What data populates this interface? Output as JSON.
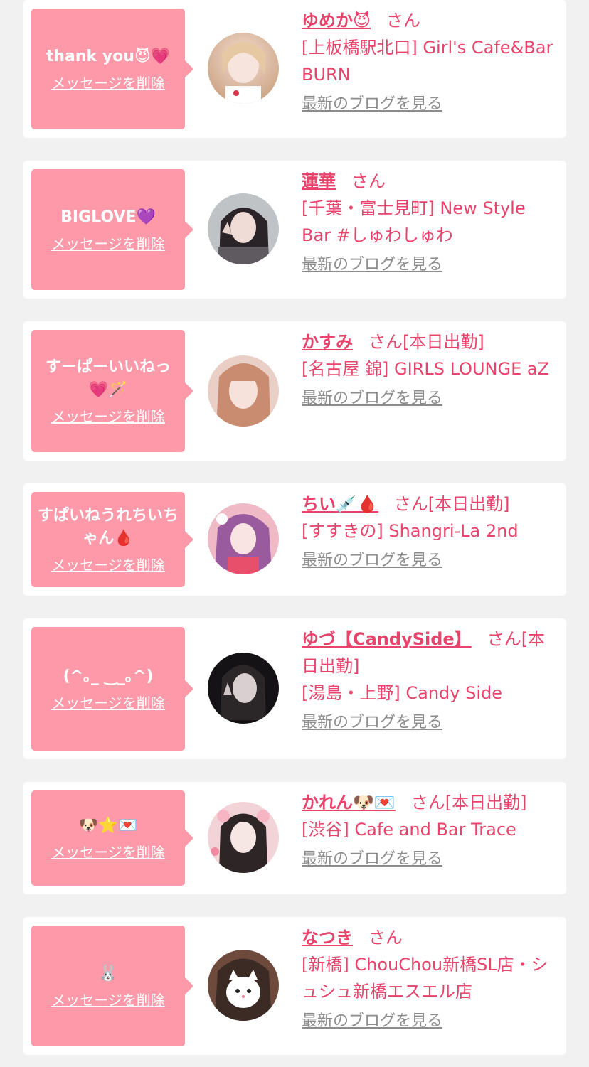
{
  "delete_label": "メッセージを削除",
  "blog_label": "最新のブログを見る",
  "san_label": "さん",
  "colors": {
    "accent": "#e8436b",
    "bubble": "#fd99a8",
    "muted": "#8c8c8c"
  },
  "cards": [
    {
      "message": "thank you😈💗",
      "name": "ゆめか😈",
      "status": "",
      "shop": "[上板橋駅北口] Girl's Cafe&Bar BURN"
    },
    {
      "message": "BIGLOVE💜",
      "name": "蓮華",
      "status": "",
      "shop": "[千葉・富士見町] New Style Bar #しゅわしゅわ"
    },
    {
      "message": "すーぱーいいねっ💗🪄",
      "name": "かすみ",
      "status": "[本日出勤]",
      "shop": "[名古屋 錦] GIRLS LOUNGE aZ"
    },
    {
      "message": "すぱいねうれちいちゃん🩸",
      "name": "ちい💉🩸",
      "status": "[本日出勤]",
      "shop": "[すすきの] Shangri-La 2nd"
    },
    {
      "message": "(^｡_ ‿_｡^)",
      "name": "ゆづ【CandySide】",
      "status": "[本日出勤]",
      "shop": "[湯島・上野] Candy Side"
    },
    {
      "message": "🐶⭐💌",
      "name": "かれん🐶💌",
      "status": "[本日出勤]",
      "shop": "[渋谷] Cafe and Bar Trace"
    },
    {
      "message": "🐰",
      "name": "なつき",
      "status": "",
      "shop": "[新橋] ChouChou新橋SL店・シュシュ新橋エスエル店"
    }
  ]
}
